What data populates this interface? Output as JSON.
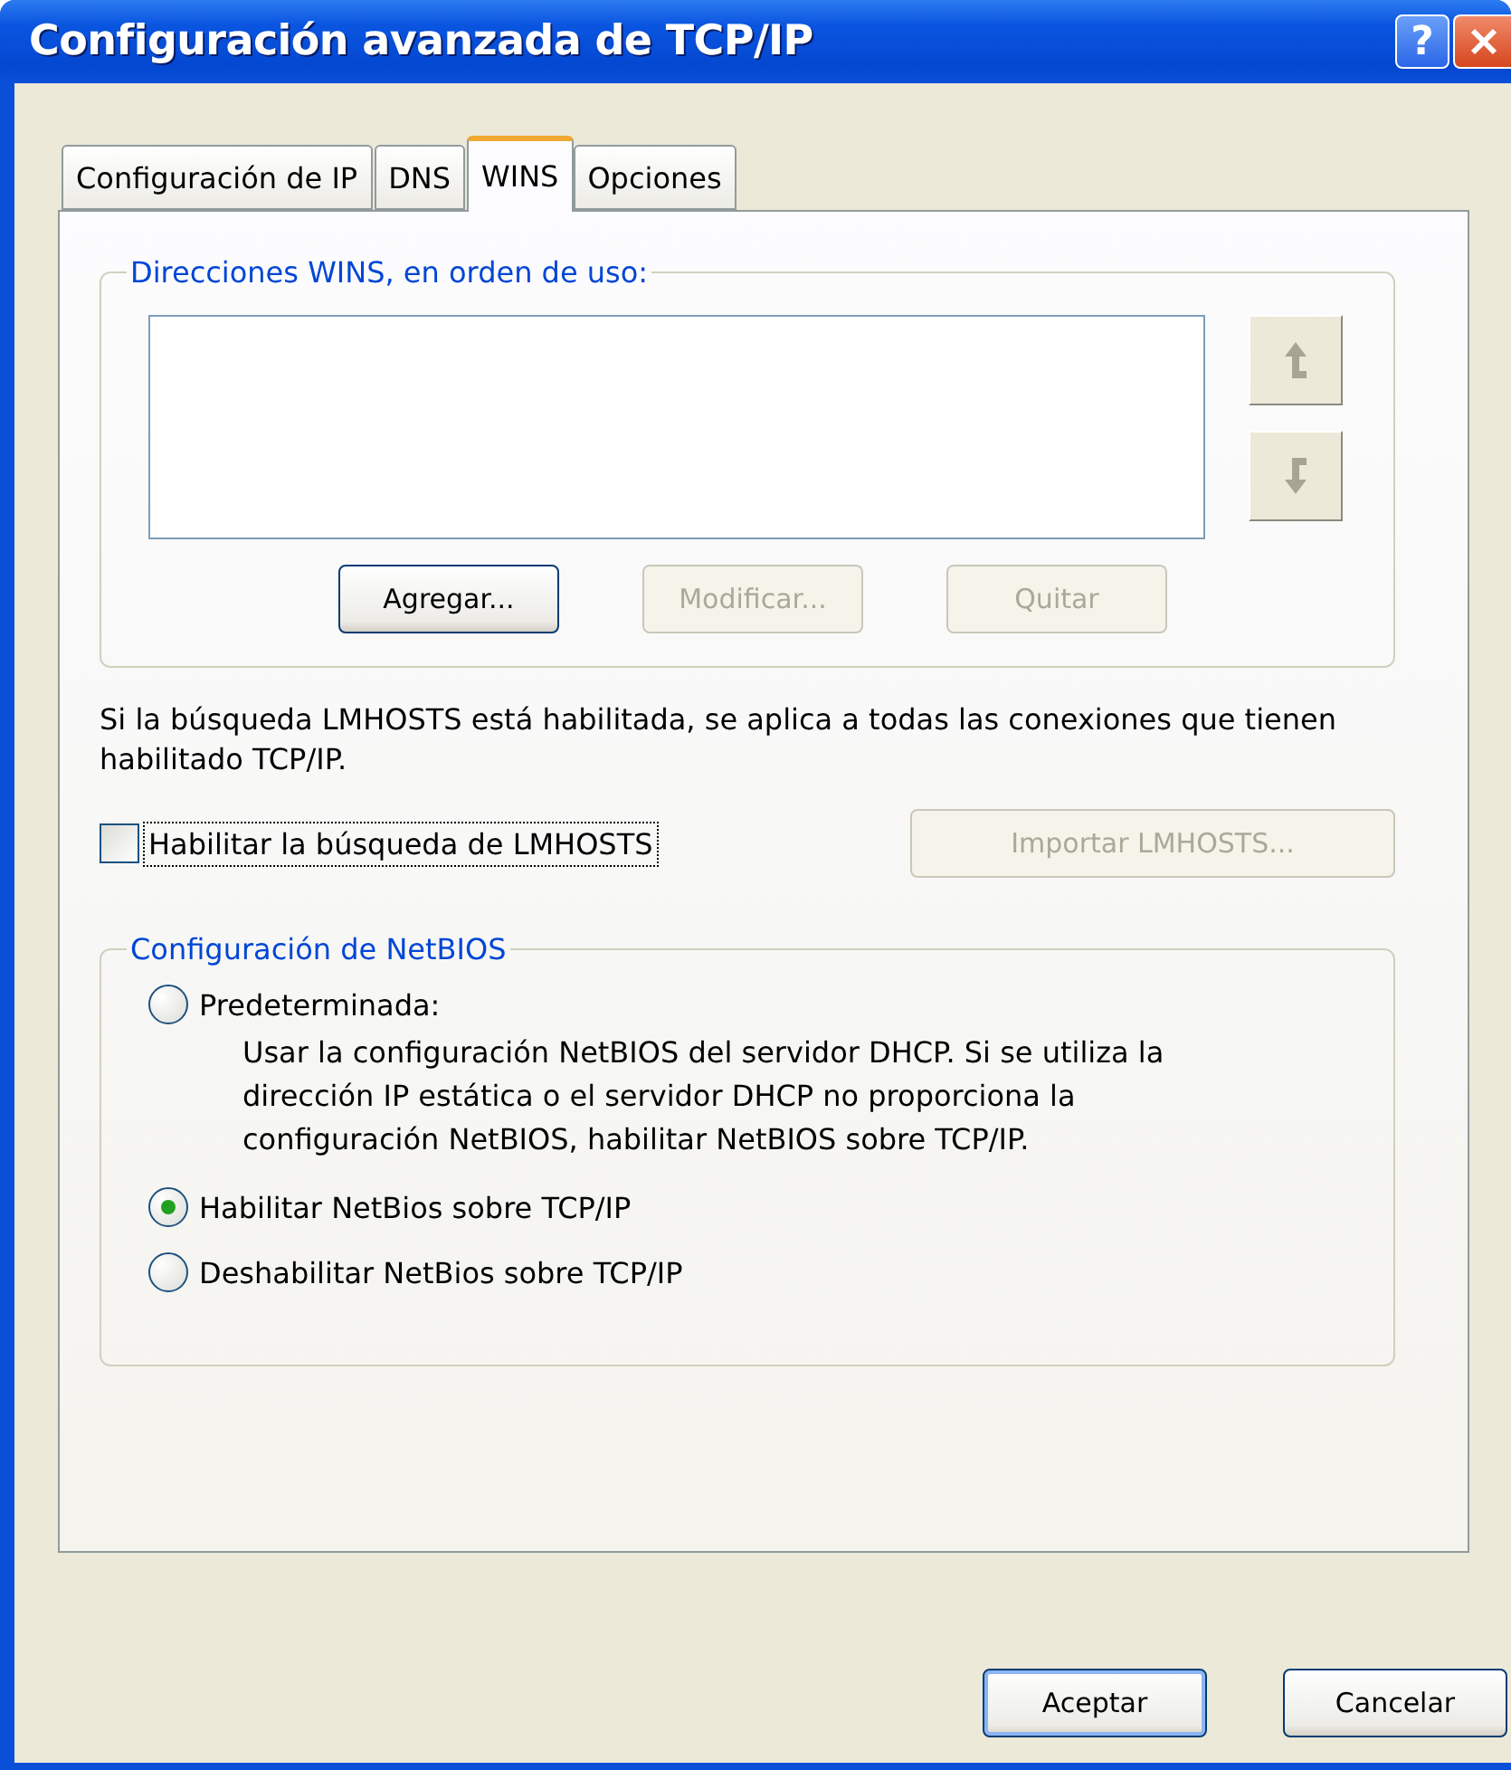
{
  "window": {
    "title": "Configuración avanzada de TCP/IP",
    "help_button": "?"
  },
  "tabs": [
    {
      "label": "Configuración de IP",
      "selected": false
    },
    {
      "label": "DNS",
      "selected": false
    },
    {
      "label": "WINS",
      "selected": true
    },
    {
      "label": "Opciones",
      "selected": false
    }
  ],
  "wins_group": {
    "legend": "Direcciones WINS, en orden de uso:",
    "buttons": [
      {
        "label": "Agregar...",
        "disabled": false
      },
      {
        "label": "Modificar...",
        "disabled": true
      },
      {
        "label": "Quitar",
        "disabled": true
      }
    ]
  },
  "lmhosts": {
    "note": "Si la búsqueda LMHOSTS está habilitada, se aplica a todas las conexiones que tienen habilitado TCP/IP.",
    "checkbox": {
      "label": "Habilitar la búsqueda de LMHOSTS",
      "checked": false,
      "focused": true
    },
    "import_button": {
      "label": "Importar LMHOSTS...",
      "disabled": true
    }
  },
  "netbios_group": {
    "legend": "Configuración de NetBIOS",
    "options": [
      {
        "label": "Predeterminada:",
        "selected": false,
        "description": "Usar la configuración NetBIOS del servidor DHCP. Si se utiliza la dirección IP estática o el servidor DHCP no proporciona la configuración NetBIOS, habilitar NetBIOS sobre TCP/IP."
      },
      {
        "label": "Habilitar NetBios sobre TCP/IP",
        "selected": true
      },
      {
        "label": "Deshabilitar NetBios sobre TCP/IP",
        "selected": false
      }
    ]
  },
  "footer_buttons": [
    {
      "label": "Aceptar",
      "default": true
    },
    {
      "label": "Cancelar",
      "default": false
    }
  ]
}
